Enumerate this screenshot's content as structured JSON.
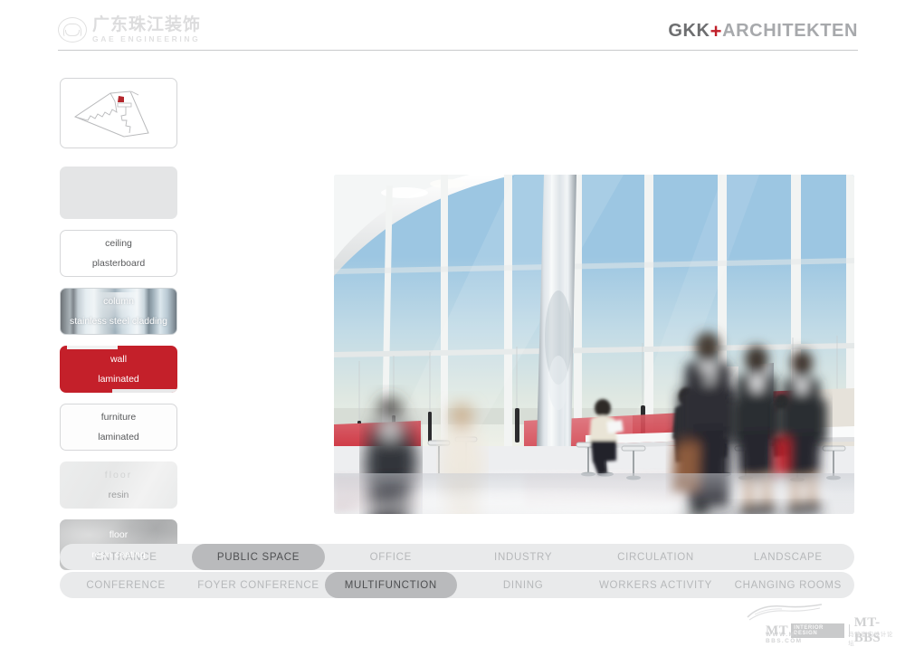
{
  "header": {
    "logo_left": {
      "icon": "company-seal-logo",
      "chinese_name": "广东珠江装饰",
      "english_name": "GAE ENGINEERING"
    },
    "logo_right": {
      "primary": "GKK",
      "separator": "+",
      "secondary": "ARCHITEKTEN"
    }
  },
  "sidebar": {
    "thumbnail": {
      "name": "floor-plan-thumbnail",
      "highlight_color": "#b4272d"
    },
    "swatches": [
      {
        "name": "blank-swatch",
        "line1": "",
        "line2": "",
        "style": "sw-blank"
      },
      {
        "name": "ceiling-swatch",
        "line1": "ceiling",
        "line2": "plasterboard",
        "style": "sw-white"
      },
      {
        "name": "column-swatch",
        "line1": "column",
        "line2": "stainless steel cladding",
        "style": "sw-steel"
      },
      {
        "name": "wall-swatch",
        "line1": "wall",
        "line2": "laminated",
        "style": "sw-red"
      },
      {
        "name": "furniture-swatch",
        "line1": "furniture",
        "line2": "laminated",
        "style": "sw-white2"
      },
      {
        "name": "floor-resin-swatch",
        "line1": "floor",
        "line2": "resin",
        "style": "sw-pale"
      },
      {
        "name": "floor-coating-swatch",
        "line1": "floor",
        "line2": "resin coating",
        "style": "sw-gray"
      }
    ]
  },
  "main": {
    "render_caption": "public space multifunction interior rendering"
  },
  "nav": {
    "row1": [
      {
        "label": "ENTRANCE",
        "active": false
      },
      {
        "label": "PUBLIC SPACE",
        "active": true
      },
      {
        "label": "OFFICE",
        "active": false
      },
      {
        "label": "INDUSTRY",
        "active": false
      },
      {
        "label": "CIRCULATION",
        "active": false
      },
      {
        "label": "LANDSCAPE",
        "active": false
      }
    ],
    "row2": [
      {
        "label": "CONFERENCE",
        "active": false
      },
      {
        "label": "FOYER CONFERENCE",
        "active": false
      },
      {
        "label": "MULTIFUNCTION",
        "active": true
      },
      {
        "label": "DINING",
        "active": false
      },
      {
        "label": "WORKERS ACTIVITY",
        "active": false
      },
      {
        "label": "CHANGING ROOMS",
        "active": false
      }
    ]
  },
  "watermark": {
    "mt": "MT",
    "badge": "INTERIOR DESIGN",
    "bbs": "MT-BBS",
    "url": "WWW.MT-BBS.COM",
    "chinese": "马蹄室内设计论坛"
  },
  "colors": {
    "accent_red": "#c4202a",
    "brand_gray": "#6d6e70",
    "nav_track": "#e9eaeb",
    "nav_active": "#b9babc"
  }
}
